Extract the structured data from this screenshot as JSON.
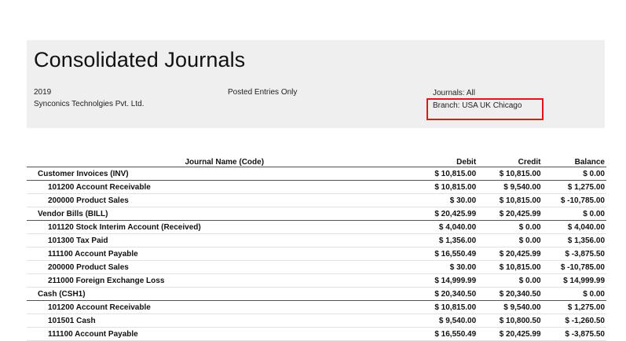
{
  "report": {
    "title": "Consolidated Journals",
    "year": "2019",
    "company": "Synconics Technolgies Pvt. Ltd.",
    "filter": "Posted Entries Only",
    "journals": "Journals: All",
    "branch": "Branch: USA UK Chicago",
    "highlight_color": "#e0141a"
  },
  "table": {
    "headers": {
      "name": "Journal Name (Code)",
      "debit": "Debit",
      "credit": "Credit",
      "balance": "Balance"
    },
    "rows": [
      {
        "type": "journal",
        "name": "Customer Invoices (INV)",
        "debit": "$ 10,815.00",
        "credit": "$ 10,815.00",
        "balance": "$ 0.00"
      },
      {
        "type": "account",
        "name": "101200 Account Receivable",
        "debit": "$ 10,815.00",
        "credit": "$ 9,540.00",
        "balance": "$ 1,275.00"
      },
      {
        "type": "account",
        "name": "200000 Product Sales",
        "debit": "$ 30.00",
        "credit": "$ 10,815.00",
        "balance": "$ -10,785.00"
      },
      {
        "type": "journal",
        "name": "Vendor Bills (BILL)",
        "debit": "$ 20,425.99",
        "credit": "$ 20,425.99",
        "balance": "$ 0.00"
      },
      {
        "type": "account",
        "name": "101120 Stock Interim Account (Received)",
        "debit": "$ 4,040.00",
        "credit": "$ 0.00",
        "balance": "$ 4,040.00"
      },
      {
        "type": "account",
        "name": "101300 Tax Paid",
        "debit": "$ 1,356.00",
        "credit": "$ 0.00",
        "balance": "$ 1,356.00"
      },
      {
        "type": "account",
        "name": "111100 Account Payable",
        "debit": "$ 16,550.49",
        "credit": "$ 20,425.99",
        "balance": "$ -3,875.50"
      },
      {
        "type": "account",
        "name": "200000 Product Sales",
        "debit": "$ 30.00",
        "credit": "$ 10,815.00",
        "balance": "$ -10,785.00"
      },
      {
        "type": "account",
        "name": "211000 Foreign Exchange Loss",
        "debit": "$ 14,999.99",
        "credit": "$ 0.00",
        "balance": "$ 14,999.99"
      },
      {
        "type": "journal",
        "name": "Cash (CSH1)",
        "debit": "$ 20,340.50",
        "credit": "$ 20,340.50",
        "balance": "$ 0.00"
      },
      {
        "type": "account",
        "name": "101200 Account Receivable",
        "debit": "$ 10,815.00",
        "credit": "$ 9,540.00",
        "balance": "$ 1,275.00"
      },
      {
        "type": "account",
        "name": "101501 Cash",
        "debit": "$ 9,540.00",
        "credit": "$ 10,800.50",
        "balance": "$ -1,260.50"
      },
      {
        "type": "account",
        "name": "111100 Account Payable",
        "debit": "$ 16,550.49",
        "credit": "$ 20,425.99",
        "balance": "$ -3,875.50"
      }
    ]
  }
}
